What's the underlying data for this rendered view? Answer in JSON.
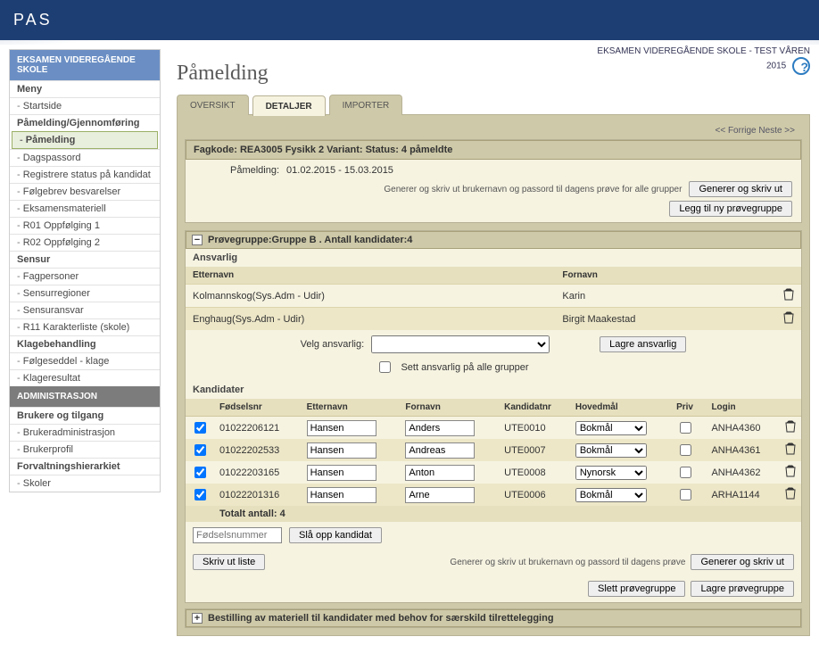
{
  "app_title": "PAS",
  "context_line": "EKSAMEN VIDEREGÅENDE SKOLE - TEST VÅREN",
  "context_year": "2015",
  "page_title": "Påmelding",
  "sidebar": {
    "section1_title": "EKSAMEN VIDEREGÅENDE SKOLE",
    "meny_label": "Meny",
    "items1": [
      "Startside"
    ],
    "group_pamelding": "Påmelding/Gjennomføring",
    "active_item": "Påmelding",
    "items_after_active": [
      "Dagspassord",
      "Registrere status på kandidat",
      "Følgebrev besvarelser",
      "Eksamensmateriell",
      "R01 Oppfølging 1",
      "R02 Oppfølging 2"
    ],
    "group_sensur": "Sensur",
    "items_sensur": [
      "Fagpersoner",
      "Sensurregioner",
      "Sensuransvar",
      "R11 Karakterliste (skole)"
    ],
    "group_klage": "Klagebehandling",
    "items_klage": [
      "Følgeseddel - klage",
      "Klageresultat"
    ],
    "section2_title": "ADMINISTRASJON",
    "group_brukere": "Brukere og tilgang",
    "items_brukere": [
      "Brukeradministrasjon",
      "Brukerprofil"
    ],
    "group_forvalt": "Forvaltningshierarkiet",
    "items_forvalt": [
      "Skoler"
    ]
  },
  "tabs": {
    "oversikt": "OVERSIKT",
    "detaljer": "DETALJER",
    "importer": "IMPORTER"
  },
  "pager": {
    "prev": "<< Forrige",
    "next": "Neste >>"
  },
  "fag": {
    "header": "Fagkode: REA3005 Fysikk 2 Variant: Status: 4 påmeldte",
    "pamelding_label": "Påmelding:",
    "pamelding_dates": "01.02.2015 - 15.03.2015",
    "gen_text": "Generer og skriv ut brukernavn og passord til dagens prøve for alle grupper",
    "gen_btn": "Generer og skriv ut",
    "legg_btn": "Legg til ny prøvegruppe"
  },
  "group": {
    "title": "Prøvegruppe:Gruppe B . Antall kandidater:4",
    "ansvarlig_label": "Ansvarlig",
    "col_etternavn": "Etternavn",
    "col_fornavn": "Fornavn",
    "ansvarlige": [
      {
        "etternavn": "Kolmannskog(Sys.Adm - Udir)",
        "fornavn": "Karin"
      },
      {
        "etternavn": "Enghaug(Sys.Adm - Udir)",
        "fornavn": "Birgit Maakestad"
      }
    ],
    "velg_label": "Velg ansvarlig:",
    "sett_cb_label": "Sett ansvarlig på alle grupper",
    "lagre_ansvarlig": "Lagre ansvarlig"
  },
  "kandidater": {
    "label": "Kandidater",
    "headers": {
      "fnr": "Fødselsnr",
      "etternavn": "Etternavn",
      "fornavn": "Fornavn",
      "kandnr": "Kandidatnr",
      "hoved": "Hovedmål",
      "priv": "Priv",
      "login": "Login"
    },
    "rows": [
      {
        "checked": true,
        "fnr": "01022206121",
        "etternavn": "Hansen",
        "fornavn": "Anders",
        "kandnr": "UTE0010",
        "hoved": "Bokmål",
        "priv": false,
        "login": "ANHA4360"
      },
      {
        "checked": true,
        "fnr": "01022202533",
        "etternavn": "Hansen",
        "fornavn": "Andreas",
        "kandnr": "UTE0007",
        "hoved": "Bokmål",
        "priv": false,
        "login": "ANHA4361"
      },
      {
        "checked": true,
        "fnr": "01022203165",
        "etternavn": "Hansen",
        "fornavn": "Anton",
        "kandnr": "UTE0008",
        "hoved": "Nynorsk",
        "priv": false,
        "login": "ANHA4362"
      },
      {
        "checked": true,
        "fnr": "01022201316",
        "etternavn": "Hansen",
        "fornavn": "Arne",
        "kandnr": "UTE0006",
        "hoved": "Bokmål",
        "priv": false,
        "login": "ARHA1144"
      }
    ],
    "hoved_options": [
      "Bokmål",
      "Nynorsk"
    ],
    "total_label": "Totalt antall: 4",
    "fnr_placeholder": "Fødselsnummer",
    "slaopp_btn": "Slå opp kandidat",
    "skriv_btn": "Skriv ut liste",
    "gen_text2": "Generer og skriv ut brukernavn og passord til dagens prøve",
    "gen_btn2": "Generer og skriv ut",
    "slett_btn": "Slett prøvegruppe",
    "lagre_btn": "Lagre prøvegruppe"
  },
  "bestilling": {
    "title": "Bestilling av materiell til kandidater med behov for særskild tilrettelegging"
  }
}
